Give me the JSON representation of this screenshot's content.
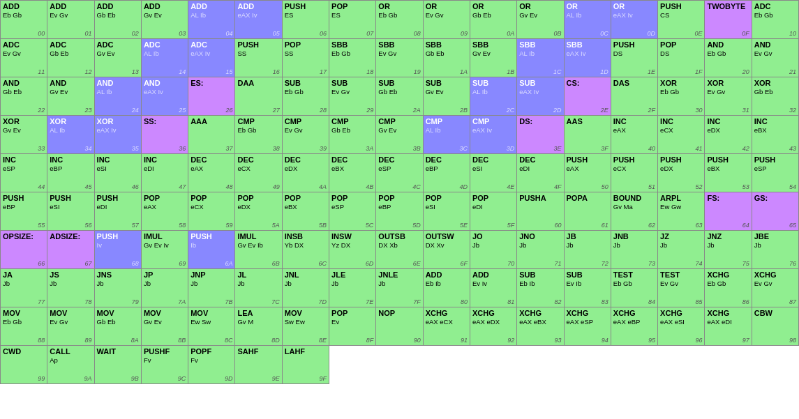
{
  "cells": [
    {
      "name": "ADD",
      "ops": "Eb Gb",
      "code": "00",
      "color": "green"
    },
    {
      "name": "ADD",
      "ops": "Ev Gv",
      "code": "01",
      "color": "green"
    },
    {
      "name": "ADD",
      "ops": "Gb Eb",
      "code": "02",
      "color": "green"
    },
    {
      "name": "ADD",
      "ops": "Gv Ev",
      "code": "03",
      "color": "green"
    },
    {
      "name": "ADD",
      "ops": "AL Ib",
      "code": "04",
      "color": "blue"
    },
    {
      "name": "ADD",
      "ops": "eAX Iv",
      "code": "05",
      "color": "blue"
    },
    {
      "name": "PUSH",
      "ops": "ES",
      "code": "06",
      "color": "green"
    },
    {
      "name": "POP",
      "ops": "ES",
      "code": "07",
      "color": "green"
    },
    {
      "name": "OR",
      "ops": "Eb Gb",
      "code": "08",
      "color": "green"
    },
    {
      "name": "OR",
      "ops": "Ev Gv",
      "code": "09",
      "color": "green"
    },
    {
      "name": "OR",
      "ops": "Gb Eb",
      "code": "0A",
      "color": "green"
    },
    {
      "name": "OR",
      "ops": "Gv Ev",
      "code": "0B",
      "color": "green"
    },
    {
      "name": "OR",
      "ops": "AL Ib",
      "code": "0C",
      "color": "blue"
    },
    {
      "name": "OR",
      "ops": "eAX Iv",
      "code": "0D",
      "color": "blue"
    },
    {
      "name": "PUSH",
      "ops": "CS",
      "code": "0E",
      "color": "green"
    },
    {
      "name": "TWOBYTE",
      "ops": "",
      "code": "0F",
      "color": "purple"
    },
    {
      "name": "ADC",
      "ops": "Eb Gb",
      "code": "10",
      "color": "green"
    },
    {
      "name": "ADC",
      "ops": "Ev Gv",
      "code": "11",
      "color": "green"
    },
    {
      "name": "ADC",
      "ops": "Gb Eb",
      "code": "12",
      "color": "green"
    },
    {
      "name": "ADC",
      "ops": "Gv Ev",
      "code": "13",
      "color": "green"
    },
    {
      "name": "ADC",
      "ops": "AL Ib",
      "code": "14",
      "color": "blue"
    },
    {
      "name": "ADC",
      "ops": "eAX Iv",
      "code": "15",
      "color": "blue"
    },
    {
      "name": "PUSH",
      "ops": "SS",
      "code": "16",
      "color": "green"
    },
    {
      "name": "POP",
      "ops": "SS",
      "code": "17",
      "color": "green"
    },
    {
      "name": "SBB",
      "ops": "Eb Gb",
      "code": "18",
      "color": "green"
    },
    {
      "name": "SBB",
      "ops": "Ev Gv",
      "code": "19",
      "color": "green"
    },
    {
      "name": "SBB",
      "ops": "Gb Eb",
      "code": "1A",
      "color": "green"
    },
    {
      "name": "SBB",
      "ops": "Gv Ev",
      "code": "1B",
      "color": "green"
    },
    {
      "name": "SBB",
      "ops": "AL Ib",
      "code": "1C",
      "color": "blue"
    },
    {
      "name": "SBB",
      "ops": "eAX Iv",
      "code": "1D",
      "color": "blue"
    },
    {
      "name": "PUSH",
      "ops": "DS",
      "code": "1E",
      "color": "green"
    },
    {
      "name": "POP",
      "ops": "DS",
      "code": "1F",
      "color": "green"
    },
    {
      "name": "AND",
      "ops": "Eb Gb",
      "code": "20",
      "color": "green"
    },
    {
      "name": "AND",
      "ops": "Ev Gv",
      "code": "21",
      "color": "green"
    },
    {
      "name": "AND",
      "ops": "Gb Eb",
      "code": "22",
      "color": "green"
    },
    {
      "name": "AND",
      "ops": "Gv Ev",
      "code": "23",
      "color": "green"
    },
    {
      "name": "AND",
      "ops": "AL Ib",
      "code": "24",
      "color": "blue"
    },
    {
      "name": "AND",
      "ops": "eAX Iv",
      "code": "25",
      "color": "blue"
    },
    {
      "name": "ES:",
      "ops": "",
      "code": "26",
      "color": "purple"
    },
    {
      "name": "DAA",
      "ops": "",
      "code": "27",
      "color": "green"
    },
    {
      "name": "SUB",
      "ops": "Eb Gb",
      "code": "28",
      "color": "green"
    },
    {
      "name": "SUB",
      "ops": "Ev Gv",
      "code": "29",
      "color": "green"
    },
    {
      "name": "SUB",
      "ops": "Gb Eb",
      "code": "2A",
      "color": "green"
    },
    {
      "name": "SUB",
      "ops": "Gv Ev",
      "code": "2B",
      "color": "green"
    },
    {
      "name": "SUB",
      "ops": "AL Ib",
      "code": "2C",
      "color": "blue"
    },
    {
      "name": "SUB",
      "ops": "eAX Iv",
      "code": "2D",
      "color": "blue"
    },
    {
      "name": "CS:",
      "ops": "",
      "code": "2E",
      "color": "purple"
    },
    {
      "name": "DAS",
      "ops": "",
      "code": "2F",
      "color": "green"
    },
    {
      "name": "XOR",
      "ops": "Eb Gb",
      "code": "30",
      "color": "green"
    },
    {
      "name": "XOR",
      "ops": "Ev Gv",
      "code": "31",
      "color": "green"
    },
    {
      "name": "XOR",
      "ops": "Gb Eb",
      "code": "32",
      "color": "green"
    },
    {
      "name": "XOR",
      "ops": "Gv Ev",
      "code": "33",
      "color": "green"
    },
    {
      "name": "XOR",
      "ops": "AL Ib",
      "code": "34",
      "color": "blue"
    },
    {
      "name": "XOR",
      "ops": "eAX Iv",
      "code": "35",
      "color": "blue"
    },
    {
      "name": "SS:",
      "ops": "",
      "code": "36",
      "color": "purple"
    },
    {
      "name": "AAA",
      "ops": "",
      "code": "37",
      "color": "green"
    },
    {
      "name": "CMP",
      "ops": "Eb Gb",
      "code": "38",
      "color": "green"
    },
    {
      "name": "CMP",
      "ops": "Ev Gv",
      "code": "39",
      "color": "green"
    },
    {
      "name": "CMP",
      "ops": "Gb Eb",
      "code": "3A",
      "color": "green"
    },
    {
      "name": "CMP",
      "ops": "Gv Ev",
      "code": "3B",
      "color": "green"
    },
    {
      "name": "CMP",
      "ops": "AL Ib",
      "code": "3C",
      "color": "blue"
    },
    {
      "name": "CMP",
      "ops": "eAX Iv",
      "code": "3D",
      "color": "blue"
    },
    {
      "name": "DS:",
      "ops": "",
      "code": "3E",
      "color": "purple"
    },
    {
      "name": "AAS",
      "ops": "",
      "code": "3F",
      "color": "green"
    },
    {
      "name": "INC",
      "ops": "eAX",
      "code": "40",
      "color": "green"
    },
    {
      "name": "INC",
      "ops": "eCX",
      "code": "41",
      "color": "green"
    },
    {
      "name": "INC",
      "ops": "eDX",
      "code": "42",
      "color": "green"
    },
    {
      "name": "INC",
      "ops": "eBX",
      "code": "43",
      "color": "green"
    },
    {
      "name": "INC",
      "ops": "eSP",
      "code": "44",
      "color": "green"
    },
    {
      "name": "INC",
      "ops": "eBP",
      "code": "45",
      "color": "green"
    },
    {
      "name": "INC",
      "ops": "eSI",
      "code": "46",
      "color": "green"
    },
    {
      "name": "INC",
      "ops": "eDI",
      "code": "47",
      "color": "green"
    },
    {
      "name": "DEC",
      "ops": "eAX",
      "code": "48",
      "color": "green"
    },
    {
      "name": "DEC",
      "ops": "eCX",
      "code": "49",
      "color": "green"
    },
    {
      "name": "DEC",
      "ops": "eDX",
      "code": "4A",
      "color": "green"
    },
    {
      "name": "DEC",
      "ops": "eBX",
      "code": "4B",
      "color": "green"
    },
    {
      "name": "DEC",
      "ops": "eSP",
      "code": "4C",
      "color": "green"
    },
    {
      "name": "DEC",
      "ops": "eBP",
      "code": "4D",
      "color": "green"
    },
    {
      "name": "DEC",
      "ops": "eSI",
      "code": "4E",
      "color": "green"
    },
    {
      "name": "DEC",
      "ops": "eDI",
      "code": "4F",
      "color": "green"
    },
    {
      "name": "PUSH",
      "ops": "eAX",
      "code": "50",
      "color": "green"
    },
    {
      "name": "PUSH",
      "ops": "eCX",
      "code": "51",
      "color": "green"
    },
    {
      "name": "PUSH",
      "ops": "eDX",
      "code": "52",
      "color": "green"
    },
    {
      "name": "PUSH",
      "ops": "eBX",
      "code": "53",
      "color": "green"
    },
    {
      "name": "PUSH",
      "ops": "eSP",
      "code": "54",
      "color": "green"
    },
    {
      "name": "PUSH",
      "ops": "eBP",
      "code": "55",
      "color": "green"
    },
    {
      "name": "PUSH",
      "ops": "eSI",
      "code": "56",
      "color": "green"
    },
    {
      "name": "PUSH",
      "ops": "eDI",
      "code": "57",
      "color": "green"
    },
    {
      "name": "POP",
      "ops": "eAX",
      "code": "58",
      "color": "green"
    },
    {
      "name": "POP",
      "ops": "eCX",
      "code": "59",
      "color": "green"
    },
    {
      "name": "POP",
      "ops": "eDX",
      "code": "5A",
      "color": "green"
    },
    {
      "name": "POP",
      "ops": "eBX",
      "code": "5B",
      "color": "green"
    },
    {
      "name": "POP",
      "ops": "eSP",
      "code": "5C",
      "color": "green"
    },
    {
      "name": "POP",
      "ops": "eBP",
      "code": "5D",
      "color": "green"
    },
    {
      "name": "POP",
      "ops": "eSI",
      "code": "5E",
      "color": "green"
    },
    {
      "name": "POP",
      "ops": "eDI",
      "code": "5F",
      "color": "green"
    },
    {
      "name": "PUSHA",
      "ops": "",
      "code": "60",
      "color": "green"
    },
    {
      "name": "POPA",
      "ops": "",
      "code": "61",
      "color": "green"
    },
    {
      "name": "BOUND",
      "ops": "Gv Ma",
      "code": "62",
      "color": "green"
    },
    {
      "name": "ARPL",
      "ops": "Ew Gw",
      "code": "63",
      "color": "green"
    },
    {
      "name": "FS:",
      "ops": "",
      "code": "64",
      "color": "purple"
    },
    {
      "name": "GS:",
      "ops": "",
      "code": "65",
      "color": "purple"
    },
    {
      "name": "OPSIZE:",
      "ops": "",
      "code": "66",
      "color": "purple"
    },
    {
      "name": "ADSIZE:",
      "ops": "",
      "code": "67",
      "color": "purple"
    },
    {
      "name": "PUSH",
      "ops": "Iv",
      "code": "68",
      "color": "blue"
    },
    {
      "name": "IMUL",
      "ops": "Gv Ev Iv",
      "code": "69",
      "color": "green"
    },
    {
      "name": "PUSH",
      "ops": "Ib",
      "code": "6A",
      "color": "blue"
    },
    {
      "name": "IMUL",
      "ops": "Gv Ev Ib",
      "code": "6B",
      "color": "green"
    },
    {
      "name": "INSB",
      "ops": "Yb DX",
      "code": "6C",
      "color": "green"
    },
    {
      "name": "INSW",
      "ops": "Yz DX",
      "code": "6D",
      "color": "green"
    },
    {
      "name": "OUTSB",
      "ops": "DX Xb",
      "code": "6E",
      "color": "green"
    },
    {
      "name": "OUTSW",
      "ops": "DX Xv",
      "code": "6F",
      "color": "green"
    },
    {
      "name": "JO",
      "ops": "Jb",
      "code": "70",
      "color": "green"
    },
    {
      "name": "JNO",
      "ops": "Jb",
      "code": "71",
      "color": "green"
    },
    {
      "name": "JB",
      "ops": "Jb",
      "code": "72",
      "color": "green"
    },
    {
      "name": "JNB",
      "ops": "Jb",
      "code": "73",
      "color": "green"
    },
    {
      "name": "JZ",
      "ops": "Jb",
      "code": "74",
      "color": "green"
    },
    {
      "name": "JNZ",
      "ops": "Jb",
      "code": "75",
      "color": "green"
    },
    {
      "name": "JBE",
      "ops": "Jb",
      "code": "76",
      "color": "green"
    },
    {
      "name": "JA",
      "ops": "Jb",
      "code": "77",
      "color": "green"
    },
    {
      "name": "JS",
      "ops": "Jb",
      "code": "78",
      "color": "green"
    },
    {
      "name": "JNS",
      "ops": "Jb",
      "code": "79",
      "color": "green"
    },
    {
      "name": "JP",
      "ops": "Jb",
      "code": "7A",
      "color": "green"
    },
    {
      "name": "JNP",
      "ops": "Jb",
      "code": "7B",
      "color": "green"
    },
    {
      "name": "JL",
      "ops": "Jb",
      "code": "7C",
      "color": "green"
    },
    {
      "name": "JNL",
      "ops": "Jb",
      "code": "7D",
      "color": "green"
    },
    {
      "name": "JLE",
      "ops": "Jb",
      "code": "7E",
      "color": "green"
    },
    {
      "name": "JNLE",
      "ops": "Jb",
      "code": "7F",
      "color": "green"
    },
    {
      "name": "ADD",
      "ops": "Eb Ib",
      "code": "80",
      "color": "green"
    },
    {
      "name": "ADD",
      "ops": "Ev Iv",
      "code": "81",
      "color": "green"
    },
    {
      "name": "SUB",
      "ops": "Eb Ib",
      "code": "82",
      "color": "green"
    },
    {
      "name": "SUB",
      "ops": "Ev Ib",
      "code": "83",
      "color": "green"
    },
    {
      "name": "TEST",
      "ops": "Eb Gb",
      "code": "84",
      "color": "green"
    },
    {
      "name": "TEST",
      "ops": "Ev Gv",
      "code": "85",
      "color": "green"
    },
    {
      "name": "XCHG",
      "ops": "Eb Gb",
      "code": "86",
      "color": "green"
    },
    {
      "name": "XCHG",
      "ops": "Ev Gv",
      "code": "87",
      "color": "green"
    },
    {
      "name": "MOV",
      "ops": "Eb Gb",
      "code": "88",
      "color": "green"
    },
    {
      "name": "MOV",
      "ops": "Ev Gv",
      "code": "89",
      "color": "green"
    },
    {
      "name": "MOV",
      "ops": "Gb Eb",
      "code": "8A",
      "color": "green"
    },
    {
      "name": "MOV",
      "ops": "Gv Ev",
      "code": "8B",
      "color": "green"
    },
    {
      "name": "MOV",
      "ops": "Ew Sw",
      "code": "8C",
      "color": "green"
    },
    {
      "name": "LEA",
      "ops": "Gv M",
      "code": "8D",
      "color": "green"
    },
    {
      "name": "MOV",
      "ops": "Sw Ew",
      "code": "8E",
      "color": "green"
    },
    {
      "name": "POP",
      "ops": "Ev",
      "code": "8F",
      "color": "green"
    },
    {
      "name": "NOP",
      "ops": "",
      "code": "90",
      "color": "green"
    },
    {
      "name": "XCHG",
      "ops": "eAX eCX",
      "code": "91",
      "color": "green"
    },
    {
      "name": "XCHG",
      "ops": "eAX eDX",
      "code": "92",
      "color": "green"
    },
    {
      "name": "XCHG",
      "ops": "eAX eBX",
      "code": "93",
      "color": "green"
    },
    {
      "name": "XCHG",
      "ops": "eAX eSP",
      "code": "94",
      "color": "green"
    },
    {
      "name": "XCHG",
      "ops": "eAX eBP",
      "code": "95",
      "color": "green"
    },
    {
      "name": "XCHG",
      "ops": "eAX eSI",
      "code": "96",
      "color": "green"
    },
    {
      "name": "XCHG",
      "ops": "eAX eDI",
      "code": "97",
      "color": "green"
    },
    {
      "name": "CBW",
      "ops": "",
      "code": "98",
      "color": "green"
    },
    {
      "name": "CWD",
      "ops": "",
      "code": "99",
      "color": "green"
    },
    {
      "name": "CALL",
      "ops": "Ap",
      "code": "9A",
      "color": "green"
    },
    {
      "name": "WAIT",
      "ops": "",
      "code": "9B",
      "color": "green"
    },
    {
      "name": "PUSHF",
      "ops": "Fv",
      "code": "9C",
      "color": "green"
    },
    {
      "name": "POPF",
      "ops": "Fv",
      "code": "9D",
      "color": "green"
    },
    {
      "name": "SAHF",
      "ops": "",
      "code": "9E",
      "color": "green"
    },
    {
      "name": "LAHF",
      "ops": "",
      "code": "9F",
      "color": "green"
    }
  ]
}
